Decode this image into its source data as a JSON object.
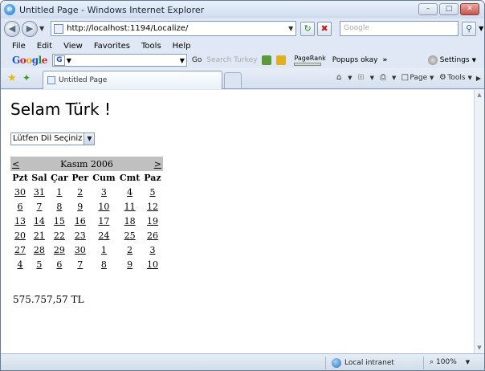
{
  "window": {
    "title": "Untitled Page - Windows Internet Explorer",
    "minimize": "–",
    "maximize": "□",
    "close": "✕"
  },
  "address_bar": {
    "url": "http://localhost:1194/Localize/",
    "search_placeholder": "Google"
  },
  "menu": {
    "items": [
      "File",
      "Edit",
      "View",
      "Favorites",
      "Tools",
      "Help"
    ]
  },
  "google_toolbar": {
    "logo_letters": [
      "G",
      "o",
      "o",
      "g",
      "l",
      "e"
    ],
    "go_label": "Go",
    "search_turkey": "Search Turkey",
    "pagerank_label": "PageRank",
    "popups_label": "Popups okay",
    "more_label": "»",
    "settings_label": "Settings"
  },
  "tabs": {
    "active_tab_title": "Untitled Page"
  },
  "command_bar": {
    "page_label": "Page",
    "tools_label": "Tools"
  },
  "content": {
    "greeting": "Selam Türk !",
    "language_select": "Lütfen Dil Seçiniz",
    "calendar": {
      "prev": "<",
      "next": ">",
      "month_title": "Kasım 2006",
      "weekdays": [
        "Pzt",
        "Sal",
        "Çar",
        "Per",
        "Cum",
        "Cmt",
        "Paz"
      ],
      "weeks": [
        [
          "30",
          "31",
          "1",
          "2",
          "3",
          "4",
          "5"
        ],
        [
          "6",
          "7",
          "8",
          "9",
          "10",
          "11",
          "12"
        ],
        [
          "13",
          "14",
          "15",
          "16",
          "17",
          "18",
          "19"
        ],
        [
          "20",
          "21",
          "22",
          "23",
          "24",
          "25",
          "26"
        ],
        [
          "27",
          "28",
          "29",
          "30",
          "1",
          "2",
          "3"
        ],
        [
          "4",
          "5",
          "6",
          "7",
          "8",
          "9",
          "10"
        ]
      ]
    },
    "price": "575.757,57 TL"
  },
  "status_bar": {
    "zone": "Local intranet",
    "zoom": "100%"
  }
}
